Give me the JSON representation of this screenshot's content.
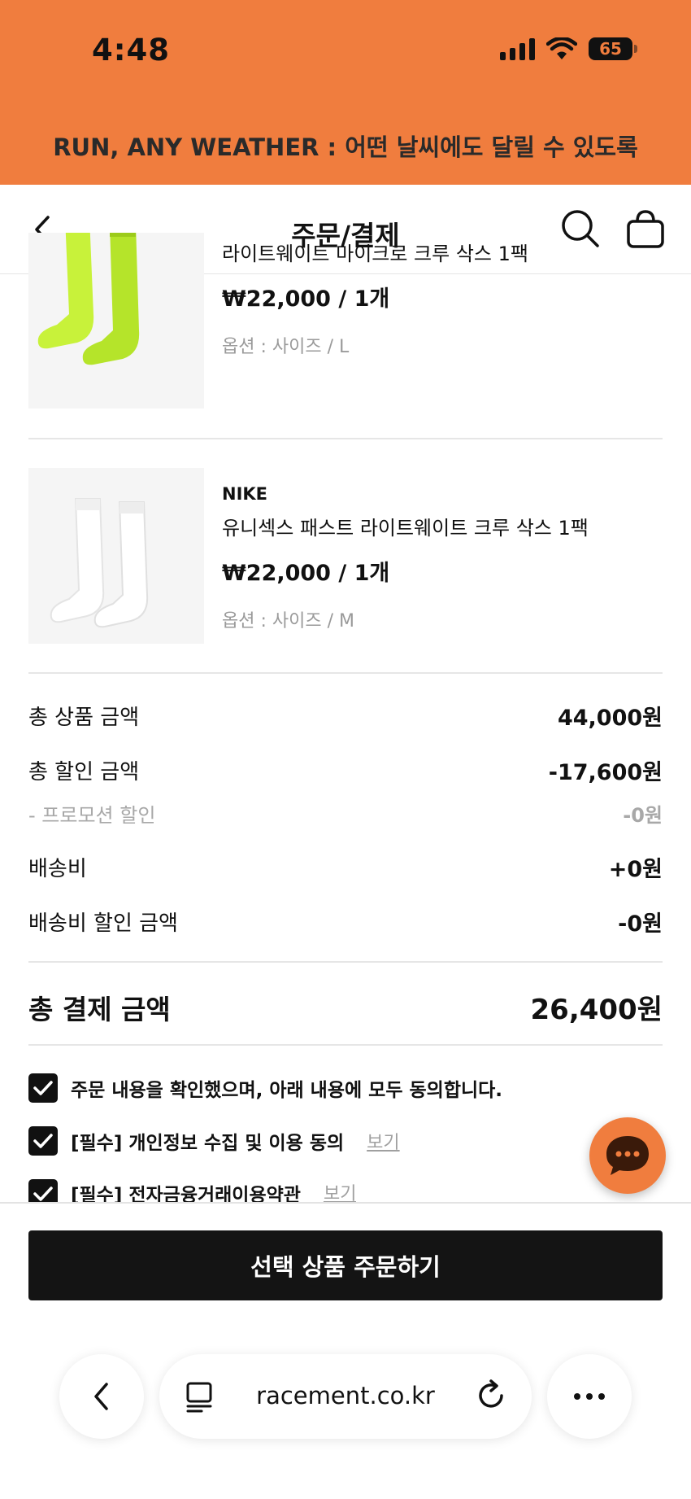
{
  "status_bar": {
    "time": "4:48",
    "battery": "65"
  },
  "banner": {
    "text": "RUN, ANY WEATHER : 어떤 날씨에도 달릴 수 있도록"
  },
  "header": {
    "title": "주문/결제"
  },
  "products": [
    {
      "brand": "",
      "name": "라이트웨이트 마이크로 크루 삭스 1팩",
      "price": "₩22,000 / 1개",
      "option": "옵션 : 사이즈 / L",
      "image_color": "#c8f23a"
    },
    {
      "brand": "NIKE",
      "name": "유니섹스 패스트 라이트웨이트 크루 삭스 1팩",
      "price": "₩22,000 / 1개",
      "option": "옵션 : 사이즈 / M",
      "image_color": "#ffffff"
    }
  ],
  "summary": {
    "product_total_label": "총 상품 금액",
    "product_total_value": "44,000원",
    "discount_label": "총 할인 금액",
    "discount_value": "-17,600원",
    "promo_label": "- 프로모션 할인",
    "promo_value": "-0원",
    "shipping_label": "배송비",
    "shipping_value": "+0원",
    "shipping_discount_label": "배송비 할인 금액",
    "shipping_discount_value": "-0원",
    "grand_total_label": "총 결제 금액",
    "grand_total_value": "26,400원"
  },
  "agreements": {
    "all": "주문 내용을 확인했으며, 아래 내용에 모두 동의합니다.",
    "privacy": "[필수] 개인정보 수집 및 이용 동의",
    "privacy_view": "보기",
    "efinance": "[필수] 전자금융거래이용약관",
    "efinance_view": "보기"
  },
  "order_button": {
    "label": "선택 상품 주문하기"
  },
  "browser": {
    "url": "racement.co.kr"
  },
  "colors": {
    "accent": "#f07d3e",
    "button": "#141414"
  }
}
